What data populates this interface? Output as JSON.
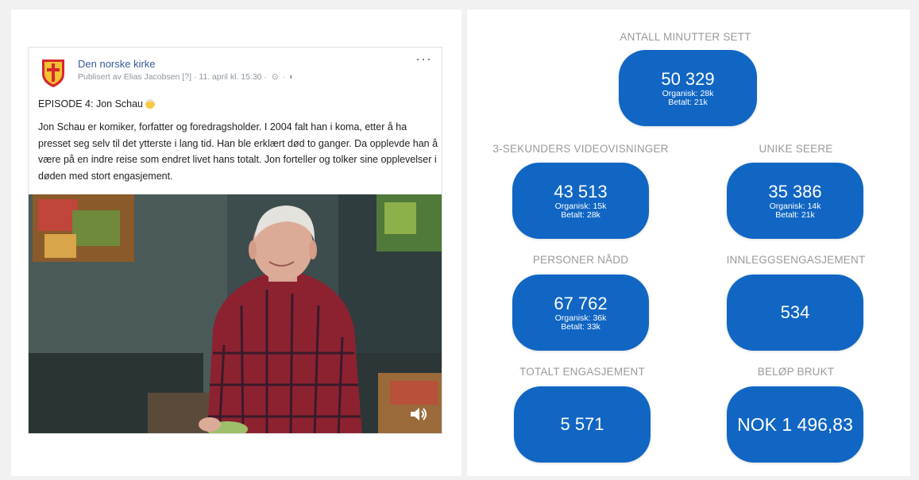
{
  "post": {
    "page_name": "Den norske kirke",
    "meta": "Publisert av Elias Jacobsen [?] · 11. april kl. 15:30 · ",
    "more_label": "···",
    "title": "EPISODE 4: Jon Schau",
    "body": "Jon Schau er komiker, forfatter og foredragsholder. I 2004 falt han i koma, etter å ha presset seg selv til det ytterste i lang tid. Han ble erklært død to ganger. Da opplevde han å være på en indre reise som endret livet hans totalt. Jon forteller og tolker sine opplevelser i døden med stort engasjement."
  },
  "stats": {
    "minutes": {
      "label": "ANTALL MINUTTER SETT",
      "value": "50 329",
      "organic": "Organisk: 28k",
      "paid": "Betalt: 21k"
    },
    "views3s": {
      "label": "3-SEKUNDERS VIDEOVISNINGER",
      "value": "43 513",
      "organic": "Organisk: 15k",
      "paid": "Betalt: 28k"
    },
    "unique": {
      "label": "UNIKE SEERE",
      "value": "35 386",
      "organic": "Organisk: 14k",
      "paid": "Betalt: 21k"
    },
    "reached": {
      "label": "PERSONER NÅDD",
      "value": "67 762",
      "organic": "Organisk: 36k",
      "paid": "Betalt: 33k"
    },
    "post_engagement": {
      "label": "INNLEGGSENGASJEMENT",
      "value": "534"
    },
    "total_engagement": {
      "label": "TOTALT ENGASJEMENT",
      "value": "5 571"
    },
    "spent": {
      "label": "BELØP BRUKT",
      "value": "NOK 1 496,83"
    }
  },
  "colors": {
    "pill": "#1166c4",
    "label": "#9a9a9a",
    "link": "#385898"
  }
}
